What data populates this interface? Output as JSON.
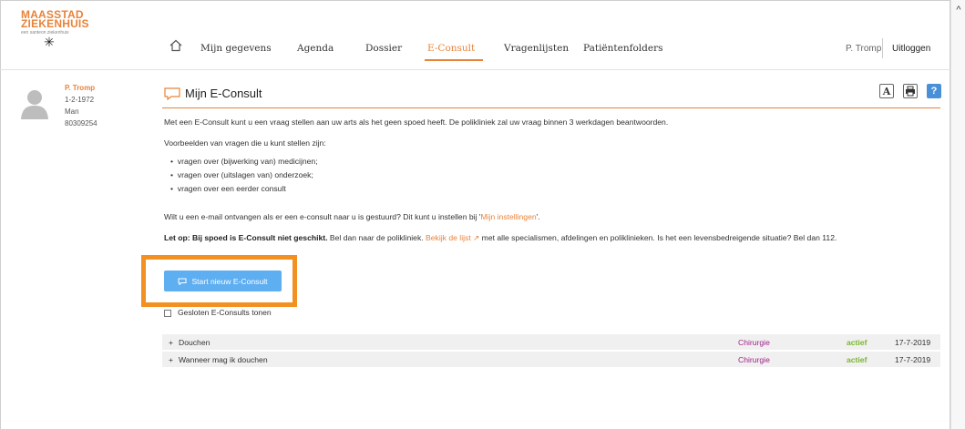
{
  "logo": {
    "line1": "MAASSTAD",
    "line2": "ZIEKENHUIS",
    "tagline": "een santeon ziekenhuis",
    "star": "✳"
  },
  "nav": {
    "home_icon": "home-icon",
    "items": [
      {
        "label": "Mijn gegevens"
      },
      {
        "label": "Agenda"
      },
      {
        "label": "Dossier"
      },
      {
        "label": "E-Consult",
        "active": true
      },
      {
        "label": "Vragenlijsten"
      },
      {
        "label": "Patiëntenfolders"
      }
    ],
    "user": "P. Tromp",
    "logout": "Uitloggen"
  },
  "patient": {
    "name": "P. Tromp",
    "dob": "1-2-1972",
    "gender": "Man",
    "number": "80309254"
  },
  "page": {
    "title": "Mijn E-Consult",
    "intro": "Met een E-Consult kunt u een vraag stellen aan uw arts als het geen spoed heeft. De polikliniek zal uw vraag binnen 3 werkdagen beantwoorden.",
    "examples_heading": "Voorbeelden van vragen die u kunt stellen zijn:",
    "examples": [
      "vragen over (bijwerking van) medicijnen;",
      "vragen over (uitslagen van) onderzoek;",
      "vragen over een eerder consult"
    ],
    "email_text": "Wilt u een e-mail ontvangen als er een e-consult naar u is gestuurd? Dit kunt u instellen bij '",
    "email_link": "Mijn instellingen",
    "email_end": "'.",
    "warning_bold": "Let op: Bij spoed is E-Consult niet geschikt.",
    "warning_text1": " Bel dan naar de polikliniek. ",
    "warning_link": "Bekijk de lijst",
    "warning_text2": " met alle specialismen, afdelingen en poliklinieken. Is het een levensbedreigende situatie? Bel dan 112.",
    "start_button": "Start nieuw E-Consult",
    "show_closed": "Gesloten E-Consults tonen"
  },
  "consults": [
    {
      "expander": "+",
      "subject": "Douchen",
      "department": "Chirurgie",
      "status": "actief",
      "date": "17-7-2019"
    },
    {
      "expander": "+",
      "subject": "Wanneer mag ik douchen",
      "department": "Chirurgie",
      "status": "actief",
      "date": "17-7-2019"
    }
  ],
  "toolbar": {
    "font_label": "A",
    "help_label": "?"
  },
  "colors": {
    "accent": "#e8833a",
    "button": "#5eaef2",
    "highlight": "#f29022",
    "category": "#a0238a",
    "status": "#7ab52f"
  }
}
